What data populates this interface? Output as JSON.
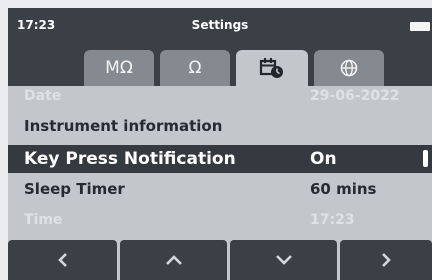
{
  "status_bar": {
    "time": "17:23",
    "title": "Settings",
    "battery_icon": "battery-icon"
  },
  "tabs": [
    {
      "label": "MΩ",
      "icon": null,
      "active": false
    },
    {
      "label": "Ω",
      "icon": null,
      "active": false
    },
    {
      "label": "",
      "icon": "calendar-clock-icon",
      "active": true
    },
    {
      "label": "",
      "icon": "globe-icon",
      "active": false
    }
  ],
  "settings": {
    "date": {
      "label": "Date",
      "value": "29-06-2022"
    },
    "instrument_info": {
      "label": "Instrument information"
    },
    "key_press": {
      "label": "Key Press Notification",
      "value": "On"
    },
    "sleep_timer": {
      "label": "Sleep Timer",
      "value": "60 mins"
    },
    "time": {
      "label": "Time",
      "value": "17:23"
    }
  },
  "nav_buttons": [
    {
      "name": "left",
      "icon": "chevron-left-icon"
    },
    {
      "name": "up",
      "icon": "chevron-up-icon"
    },
    {
      "name": "down",
      "icon": "chevron-down-icon"
    },
    {
      "name": "right",
      "icon": "chevron-right-icon"
    }
  ],
  "colors": {
    "bar_background": "#3b4047",
    "panel_background": "#c3c7cc",
    "inactive_tab": "#858a91",
    "selected_row": "#353a41"
  }
}
